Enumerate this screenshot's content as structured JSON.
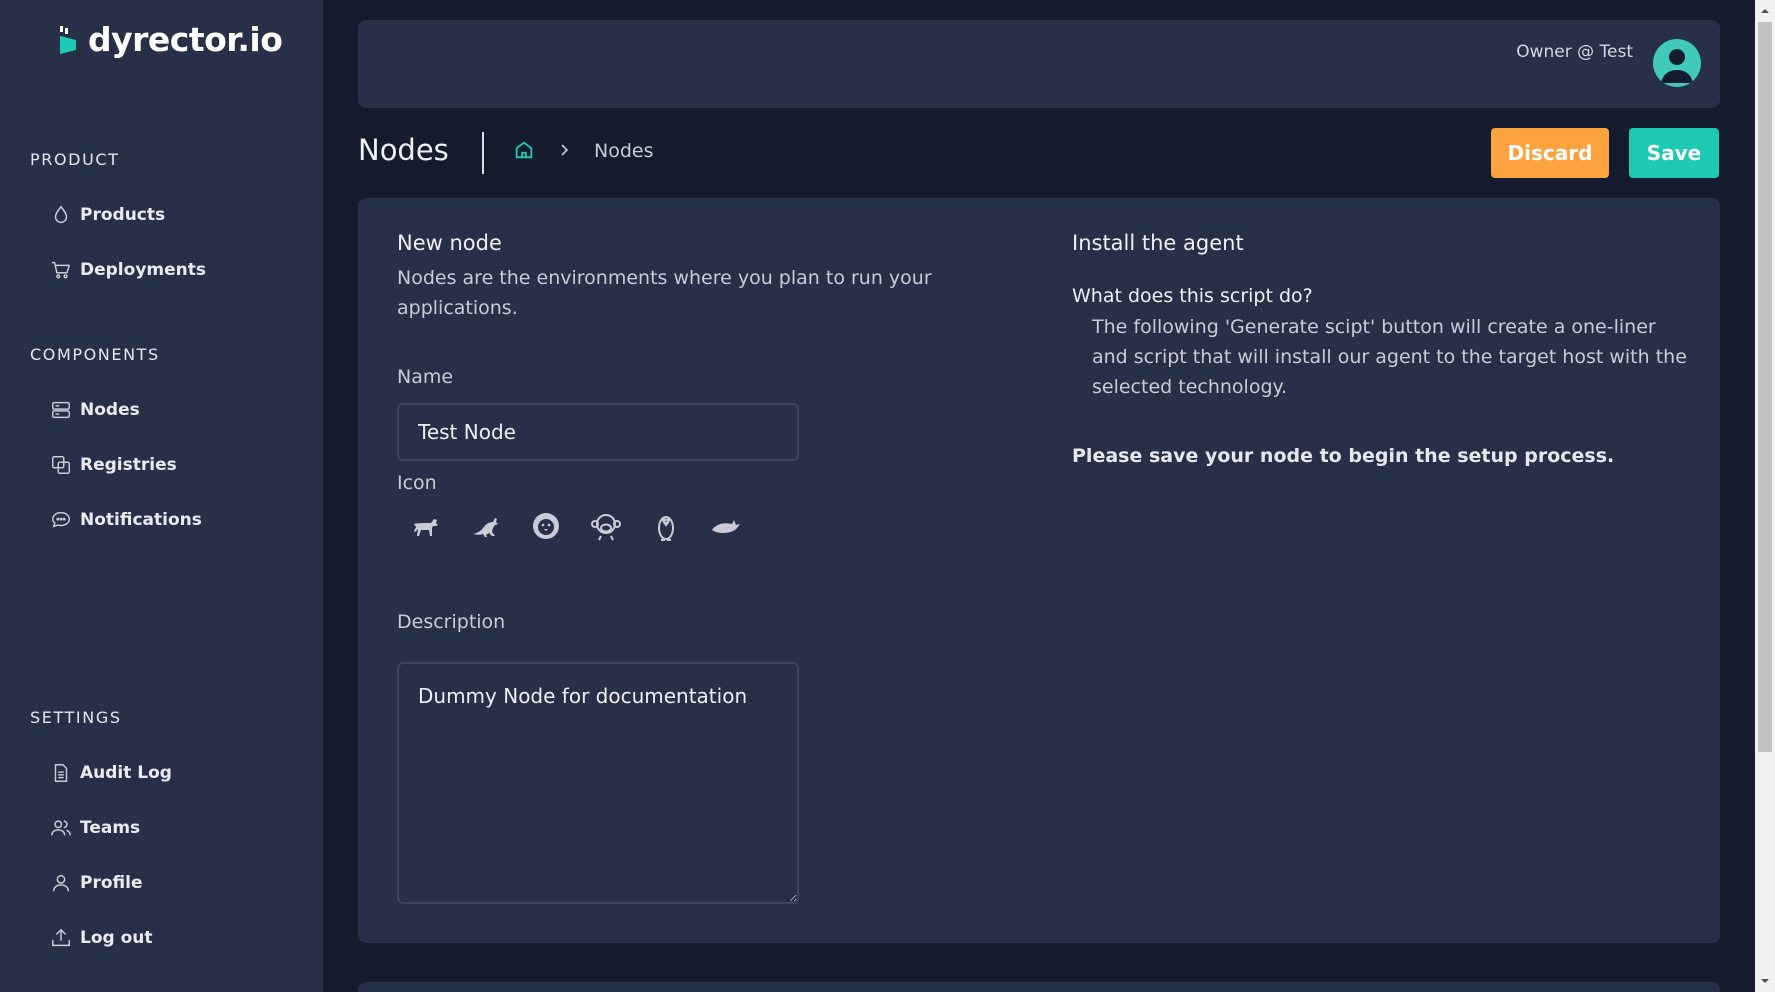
{
  "app": {
    "logo": "dyrector.io",
    "accent": "#1fcab5"
  },
  "sidebar": {
    "sections": [
      {
        "title": "PRODUCT",
        "items": [
          {
            "label": "Products",
            "icon": "cube-icon"
          },
          {
            "label": "Deployments",
            "icon": "cart-icon"
          }
        ]
      },
      {
        "title": "COMPONENTS",
        "items": [
          {
            "label": "Nodes",
            "icon": "server-icon"
          },
          {
            "label": "Registries",
            "icon": "copy-icon"
          },
          {
            "label": "Notifications",
            "icon": "chat-icon"
          }
        ]
      },
      {
        "title": "SETTINGS",
        "items": [
          {
            "label": "Audit Log",
            "icon": "document-icon"
          },
          {
            "label": "Teams",
            "icon": "users-icon"
          },
          {
            "label": "Profile",
            "icon": "user-icon"
          },
          {
            "label": "Log out",
            "icon": "upload-icon"
          }
        ]
      }
    ]
  },
  "header": {
    "user": "Owner @ Test"
  },
  "page": {
    "title": "Nodes",
    "breadcrumb": "Nodes",
    "discard_label": "Discard",
    "save_label": "Save"
  },
  "form": {
    "heading": "New node",
    "description": "Nodes are the environments where you plan to run your applications.",
    "name_label": "Name",
    "name_value": "Test Node",
    "icon_label": "Icon",
    "icons": [
      "dog-icon",
      "kangaroo-icon",
      "lion-icon",
      "monkey-icon",
      "penguin-icon",
      "whale-icon"
    ],
    "description_label": "Description",
    "description_value": "Dummy Node for documentation"
  },
  "agent": {
    "heading": "Install the agent",
    "question": "What does this script do?",
    "answer": "The following 'Generate scipt' button will create a one-liner and script that will install our agent to the target host with the selected technology.",
    "note": "Please save your node to begin the setup process."
  }
}
